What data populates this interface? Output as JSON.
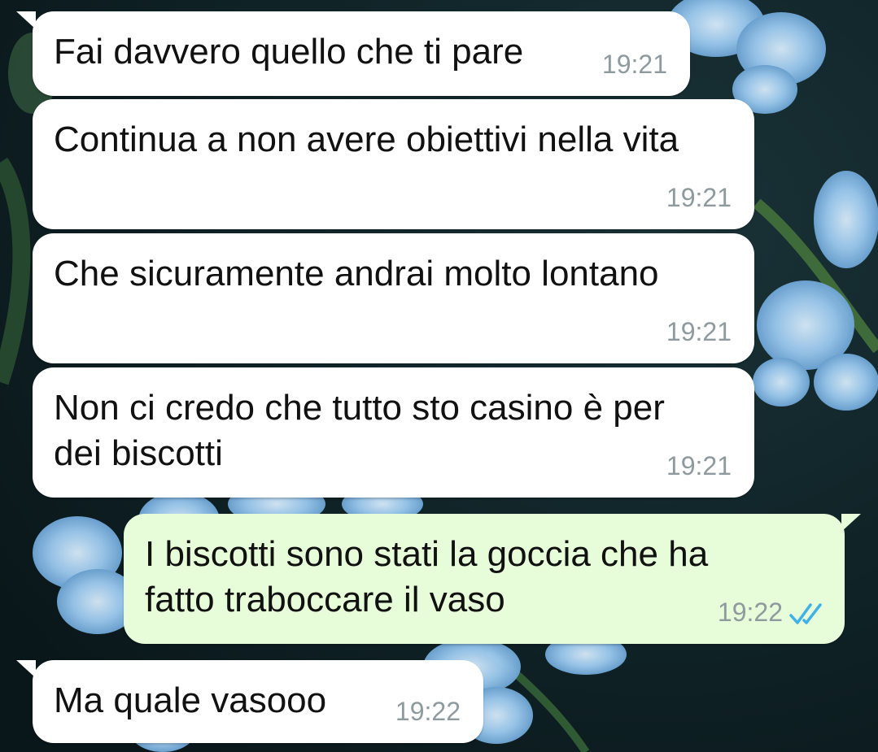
{
  "colors": {
    "incoming_bubble": "#ffffff",
    "outgoing_bubble": "#e7fcd8",
    "timestamp": "#8e9a9e",
    "read_ticks": "#3fb1e6",
    "wallpaper_background": "#0e1e22",
    "wallpaper_flowers": "#8ec2ee"
  },
  "chat": {
    "messages": [
      {
        "direction": "incoming",
        "text": "Fai davvero quello che ti pare",
        "time": "19:21"
      },
      {
        "direction": "incoming",
        "text": "Continua a non avere obiettivi nella vita",
        "time": "19:21"
      },
      {
        "direction": "incoming",
        "text": "Che sicuramente andrai molto lontano",
        "time": "19:21"
      },
      {
        "direction": "incoming",
        "text": "Non ci credo che tutto sto casino è per\ndei biscotti",
        "time": "19:21"
      },
      {
        "direction": "outgoing",
        "text": "I biscotti sono stati la goccia che ha\nfatto traboccare il vaso",
        "time": "19:22",
        "status_icon": "double-check-read-icon"
      },
      {
        "direction": "incoming",
        "text": "Ma quale vasooo",
        "time": "19:22"
      }
    ]
  }
}
